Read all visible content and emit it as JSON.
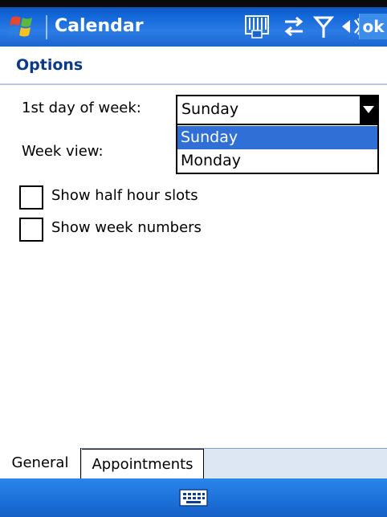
{
  "titlebar": {
    "app_title": "Calendar",
    "ok_label": "ok",
    "icons": [
      "windows-start-icon",
      "keyboard-status-icon",
      "sync-icon",
      "signal-icon",
      "volume-icon"
    ]
  },
  "page": {
    "title": "Options"
  },
  "form": {
    "first_day_label": "1st day of week:",
    "first_day_value": "Sunday",
    "first_day_options": [
      "Sunday",
      "Monday"
    ],
    "week_view_label": "Week view:",
    "checkboxes": [
      {
        "label": "Show half hour slots",
        "checked": false
      },
      {
        "label": "Show week numbers",
        "checked": false
      }
    ]
  },
  "tabs": [
    {
      "label": "General",
      "active": true
    },
    {
      "label": "Appointments",
      "active": false
    }
  ],
  "bottombar": {
    "icon": "keyboard-icon"
  },
  "colors": {
    "titlebar_blue": "#1166d8",
    "heading_blue": "#0a3a8c",
    "selection_blue": "#2f6fd6"
  }
}
